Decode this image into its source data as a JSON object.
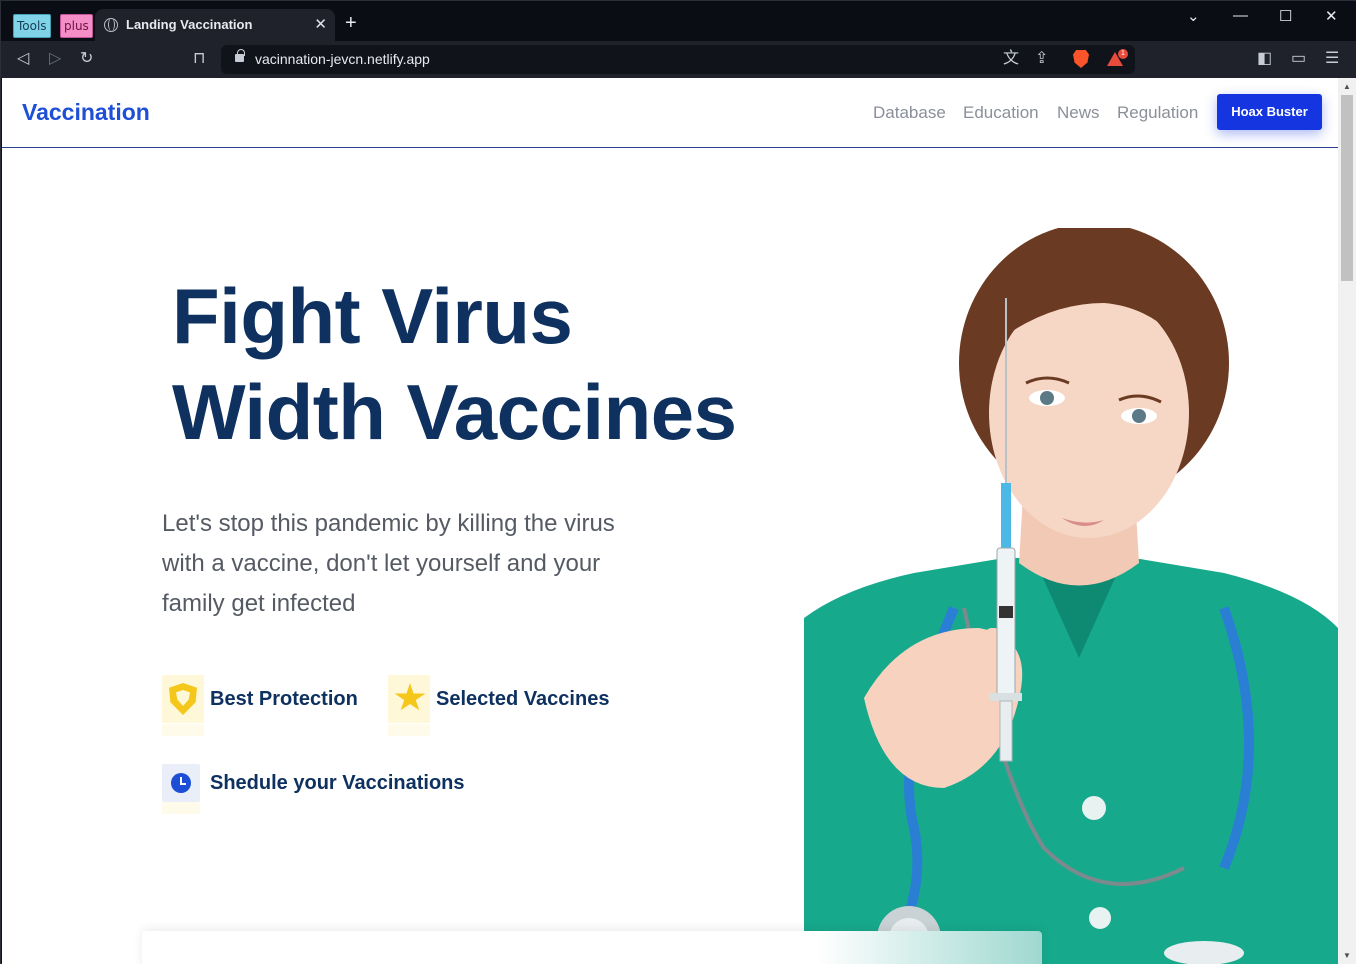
{
  "browser": {
    "pinned_tabs": [
      "Tools",
      "plus"
    ],
    "active_tab_title": "Landing Vaccination",
    "url": "vacinnation-jevcn.netlify.app",
    "shield_badge_count": "1"
  },
  "site": {
    "brand": "Vaccination",
    "nav_links": [
      "Database",
      "Education",
      "News",
      "Regulation"
    ],
    "cta_label": "Hoax Buster"
  },
  "hero": {
    "title_line1": "Fight Virus",
    "title_line2": "Width Vaccines",
    "subtitle_line1": "Let's stop this pandemic by killing the virus",
    "subtitle_line2": "with a vaccine, don't let yourself and your",
    "subtitle_line3": "family get infected"
  },
  "features": [
    {
      "label": "Best Protection",
      "icon": "shield-icon"
    },
    {
      "label": "Selected Vaccines",
      "icon": "star-icon"
    },
    {
      "label": "Shedule your Vaccinations",
      "icon": "clock-icon"
    }
  ],
  "colors": {
    "brand_blue": "#1f4fd6",
    "cta_blue": "#1535e0",
    "heading_navy": "#0e3160",
    "icon_yellow": "#f5c71a",
    "scrub_green": "#17a98c"
  }
}
